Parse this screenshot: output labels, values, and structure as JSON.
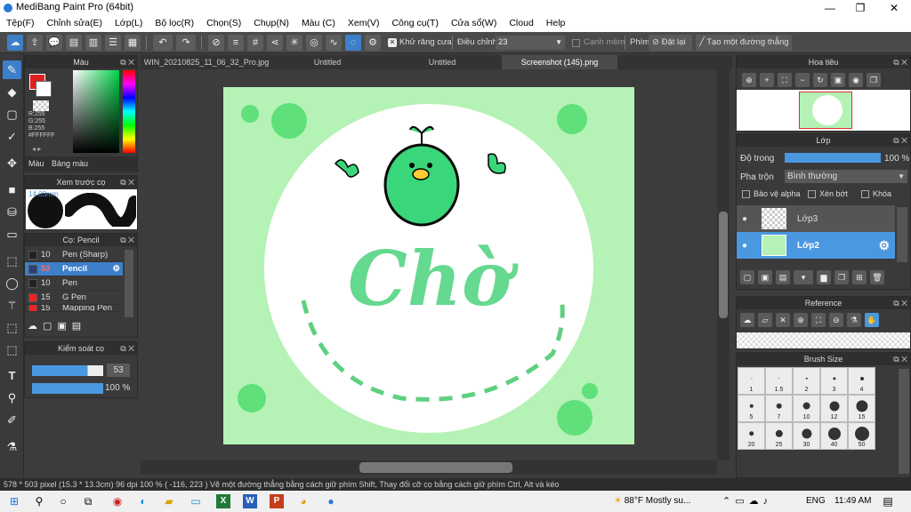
{
  "window": {
    "title": "MediBang Paint Pro (64bit)"
  },
  "menu": [
    "Tệp(F)",
    "Chỉnh sửa(E)",
    "Lớp(L)",
    "Bộ lọc(R)",
    "Chọn(S)",
    "Chụp(N)",
    "Màu (C)",
    "Xem(V)",
    "Công cụ(T)",
    "Cửa sổ(W)",
    "Cloud",
    "Help"
  ],
  "toolbar": {
    "antialias": "Khử răng cưa",
    "adjust": "Điều chỉnh",
    "adjust_value": "23",
    "soft_edge": "Cạnh mềm",
    "pen_label": "Phím",
    "reset": "Đặt lại",
    "line_btn": "Tạo một đường thẳng"
  },
  "tabs": [
    "WIN_20210825_11_06_32_Pro.jpg",
    "Untitled",
    "Untitled",
    "Screenshot (145).png"
  ],
  "color_panel": {
    "title": "Màu",
    "r": "R:255",
    "g": "G:255",
    "b": "B:255",
    "hex": "#FFFFFF",
    "tab1": "Màu",
    "tab2": "Bảng màu"
  },
  "brush_preview": {
    "title": "Xem trước cọ",
    "size": "14.03mm"
  },
  "brush_panel": {
    "title": "Cọ: Pencil",
    "items": [
      {
        "size": "10",
        "name": "Pen (Sharp)"
      },
      {
        "size": "53",
        "name": "Pencil"
      },
      {
        "size": "10",
        "name": "Pen"
      },
      {
        "size": "15",
        "name": "G Pen"
      },
      {
        "size": "15",
        "name": "Mapping Pen"
      }
    ]
  },
  "brush_control": {
    "title": "Kiểm soát cọ",
    "size": "53",
    "opacity": "100 %"
  },
  "navigator": {
    "title": "Hoa tiêu"
  },
  "layer": {
    "title": "Lớp",
    "opacity_label": "Độ trong",
    "opacity": "100 %",
    "blend_label": "Pha trộn",
    "blend": "Bình thường",
    "protect": "Bảo vệ alpha",
    "clip": "Xén bớt",
    "lock": "Khóa",
    "layers": [
      "Lớp3",
      "Lớp2"
    ]
  },
  "reference": {
    "title": "Reference"
  },
  "brush_size": {
    "title": "Brush Size",
    "sizes": [
      "1",
      "1.5",
      "2",
      "3",
      "4",
      "5",
      "7",
      "10",
      "12",
      "15",
      "20",
      "25",
      "30",
      "40",
      "50"
    ]
  },
  "artwork": {
    "text": "Chờ"
  },
  "status": {
    "text": "578 * 503 pixel   (15.3 * 13.3cm)   96 dpi   100 %   ( -116, 223 )   Vẽ một đường thẳng bằng cách giữ phím Shift, Thay đổi cỡ cọ bằng cách giữ phím Ctrl, Alt và kéo"
  },
  "taskbar": {
    "weather": "88°F  Mostly su...",
    "lang": "ENG",
    "time": "11:49 AM"
  }
}
